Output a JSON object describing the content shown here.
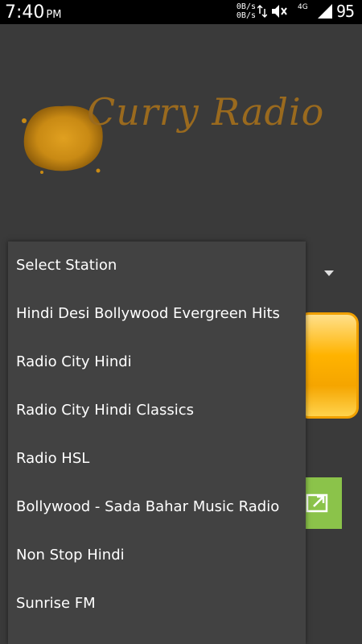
{
  "status_bar": {
    "time": "7:40",
    "ampm": "PM",
    "net_up": "0B/s",
    "net_down": "0B/s",
    "network_label": "4G",
    "battery": "95"
  },
  "app": {
    "logo_text": "Curry Radio",
    "colors": {
      "background": "#3a3a3a",
      "logo_text": "#9a6a1e",
      "play_button": "#ffb300",
      "share_button": "#8bc34a"
    }
  },
  "dropdown": {
    "items": [
      "Select Station",
      "Hindi Desi Bollywood Evergreen Hits",
      "Radio City Hindi",
      "Radio City Hindi Classics",
      "Radio HSL",
      "Bollywood - Sada Bahar Music Radio",
      "Non Stop Hindi",
      "Sunrise FM"
    ]
  },
  "icons": {
    "vibrate": "mute-icon",
    "data": "data-transfer-icon",
    "signal": "signal-icon",
    "share": "share-icon",
    "spinner": "chevron-down-icon"
  }
}
